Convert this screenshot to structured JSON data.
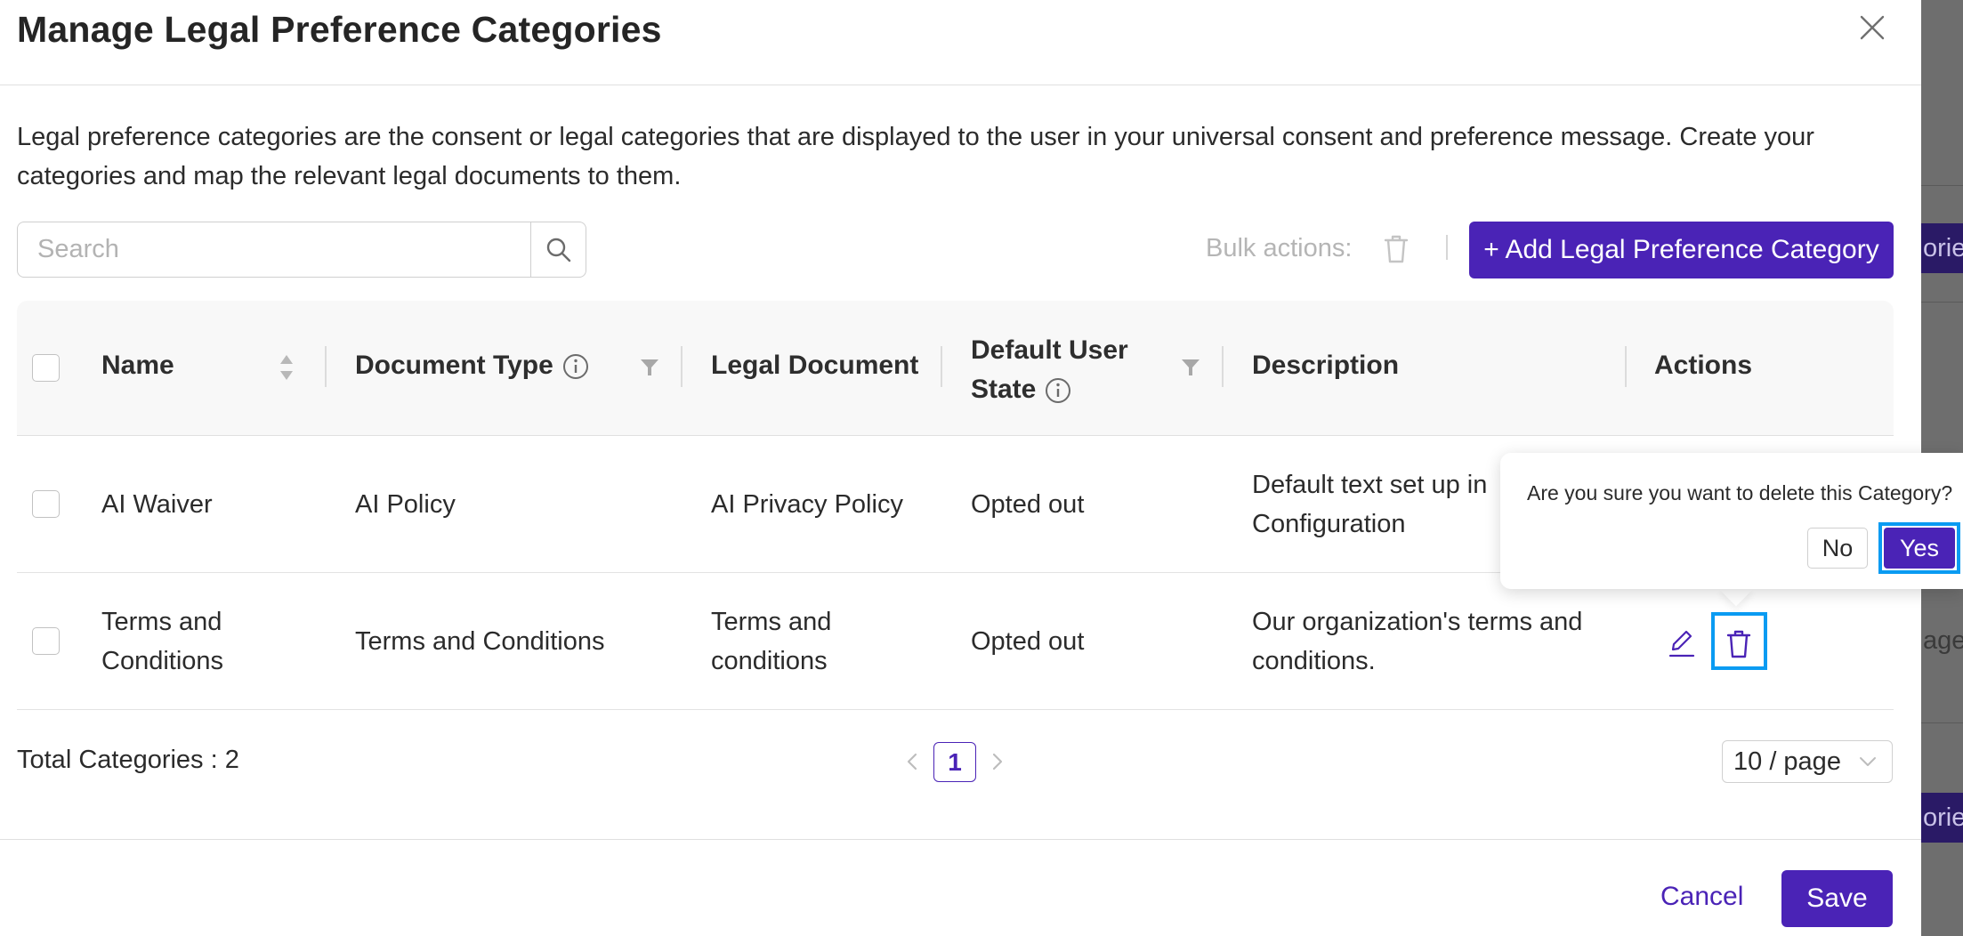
{
  "modal": {
    "title": "Manage Legal Preference Categories",
    "intro": "Legal preference categories are the consent or legal categories that are displayed to the user in your universal consent and preference message. Create your categories and map the relevant legal documents to them."
  },
  "toolbar": {
    "search_placeholder": "Search",
    "bulk_actions_label": "Bulk actions:",
    "add_button_label": "+ Add Legal Preference Category"
  },
  "table": {
    "headers": {
      "name": "Name",
      "document_type": "Document Type",
      "legal_document": "Legal Document",
      "default_user_state_line1": "Default User",
      "default_user_state_line2": "State",
      "description": "Description",
      "actions": "Actions"
    },
    "rows": [
      {
        "name": "AI Waiver",
        "document_type": "AI Policy",
        "legal_document": "AI Privacy Policy",
        "default_user_state": "Opted out",
        "description_line1": "Default text set up in",
        "description_line2": "Configuration"
      },
      {
        "name_line1": "Terms and",
        "name_line2": "Conditions",
        "document_type": "Terms and Conditions",
        "legal_document_line1": "Terms and",
        "legal_document_line2": "conditions",
        "default_user_state": "Opted out",
        "description_line1": "Our organization's terms and",
        "description_line2": "conditions."
      }
    ]
  },
  "footer": {
    "total_label": "Total Categories : 2",
    "current_page": "1",
    "page_size": "10 / page"
  },
  "popconfirm": {
    "message": "Are you sure you want to delete this Category?",
    "no_label": "No",
    "yes_label": "Yes"
  },
  "actions": {
    "cancel_label": "Cancel",
    "save_label": "Save"
  },
  "background": {
    "button_text": "orie",
    "row_text": "age"
  },
  "colors": {
    "accent": "#4a23b6",
    "highlight": "#0a9bf2"
  },
  "icons": [
    "close-icon",
    "search-icon",
    "trash-icon",
    "sort-icon",
    "info-icon",
    "filter-icon",
    "edit-icon",
    "chevron-left-icon",
    "chevron-right-icon",
    "chevron-down-icon"
  ]
}
